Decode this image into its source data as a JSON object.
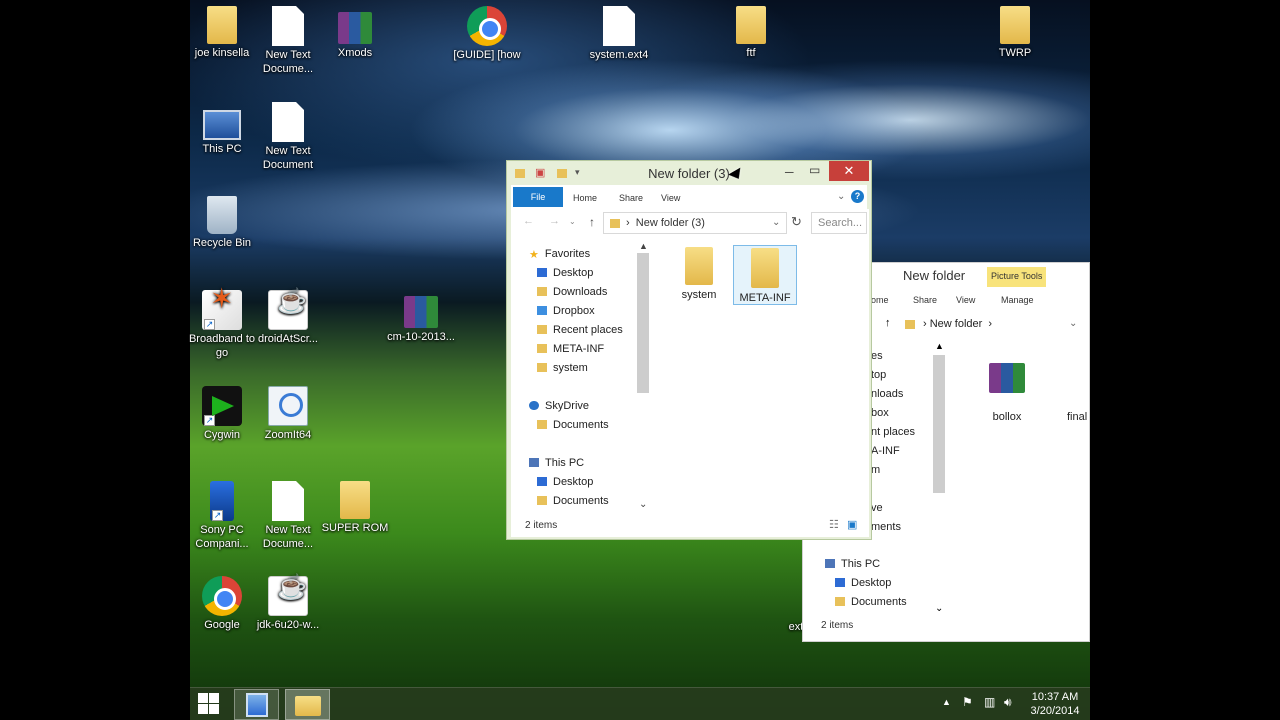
{
  "desktop": {
    "icons": [
      {
        "label": "joe kinsella",
        "icon": "user-folder-icon"
      },
      {
        "label": "New Text Docume...",
        "icon": "text-document-icon"
      },
      {
        "label": "Xmods",
        "icon": "winrar-archive-icon"
      },
      {
        "label": "[GUIDE] [how",
        "icon": "chrome-shortcut-icon"
      },
      {
        "label": "system.ext4",
        "icon": "file-icon"
      },
      {
        "label": "ftf",
        "icon": "folder-icon"
      },
      {
        "label": "TWRP",
        "icon": "folder-icon"
      },
      {
        "label": "This PC",
        "icon": "this-pc-icon"
      },
      {
        "label": "New Text Document",
        "icon": "text-document-icon"
      },
      {
        "label": "Recycle Bin",
        "icon": "recycle-bin-icon"
      },
      {
        "label": "Broadband to go",
        "icon": "broadband-app-icon"
      },
      {
        "label": "droidAtScr...",
        "icon": "java-icon"
      },
      {
        "label": "cm-10-2013...",
        "icon": "winrar-archive-icon"
      },
      {
        "label": "Cygwin",
        "icon": "cygwin-icon"
      },
      {
        "label": "ZoomIt64",
        "icon": "zoomit-icon"
      },
      {
        "label": "Sony PC Compani...",
        "icon": "sony-pc-companion-icon"
      },
      {
        "label": "New Text Docume...",
        "icon": "text-document-icon"
      },
      {
        "label": "SUPER ROM",
        "icon": "folder-icon"
      },
      {
        "label": "Google",
        "icon": "chrome-shortcut-icon"
      },
      {
        "label": "jdk-6u20-w...",
        "icon": "java-installer-icon"
      }
    ],
    "partial_label": "ext"
  },
  "front_window": {
    "title": "New folder (3)",
    "tabs": {
      "file": "File",
      "home": "Home",
      "share": "Share",
      "view": "View"
    },
    "address": "New folder (3)",
    "search_placeholder": "Search...",
    "nav": {
      "favorites": "Favorites",
      "desktop": "Desktop",
      "downloads": "Downloads",
      "dropbox": "Dropbox",
      "recent": "Recent places",
      "meta_inf": "META-INF",
      "system": "system",
      "skydrive": "SkyDrive",
      "sky_documents": "Documents",
      "this_pc": "This PC",
      "pc_desktop": "Desktop",
      "pc_documents": "Documents"
    },
    "items": [
      {
        "label": "system",
        "icon": "folder-icon"
      },
      {
        "label": "META-INF",
        "icon": "folder-icon",
        "selected": true
      }
    ],
    "status": "2 items"
  },
  "back_window": {
    "title": "New folder",
    "context_tab": "Picture Tools",
    "tabs": {
      "home": "ome",
      "share": "Share",
      "view": "View",
      "manage": "Manage"
    },
    "address": "New folder",
    "nav": {
      "favorites": "es",
      "desktop": "top",
      "downloads": "nloads",
      "dropbox": "box",
      "recent": "nt places",
      "meta_inf": "A-INF",
      "system": "m",
      "skydrive": "ve",
      "documents": "ments",
      "this_pc": "This PC",
      "pc_desktop": "Desktop",
      "pc_documents": "Documents"
    },
    "items": [
      {
        "label": "bollox",
        "icon": "winrar-archive-icon"
      },
      {
        "label": "final",
        "icon": "file-icon"
      }
    ],
    "status": "2 items"
  },
  "taskbar": {
    "time": "10:37 AM",
    "date": "3/20/2014",
    "colors": {
      "accent": "#1979ca",
      "close": "#c7403a"
    }
  }
}
